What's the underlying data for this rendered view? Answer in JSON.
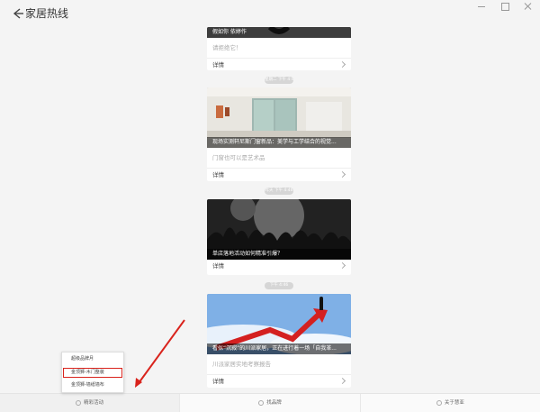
{
  "header": {
    "title": "家居热线"
  },
  "feed": {
    "cards": [
      {
        "caption": "假如你 依婷作",
        "subtitle": "请拒绝它！",
        "detail_label": "详情"
      },
      {
        "date_pill": "星期二 下午 4:46",
        "caption": "现场实测轩尼斯门窗新品：美学与工学结合的视觉...",
        "subtitle": "门窗也可以是艺术品",
        "detail_label": "详情"
      },
      {
        "date_pill": "昨天 下午 4:46",
        "caption": "单店落地活动如何精准引爆？",
        "detail_label": "详情"
      },
      {
        "date_pill": "下午 4:46",
        "caption": "看似“沉寂”的川派家居，正在进行着一场「自我革...",
        "subtitle": "川派家居实地考察报告",
        "detail_label": "详情"
      }
    ]
  },
  "bottom_nav": {
    "tabs": [
      {
        "label": "精彩活动"
      },
      {
        "label": "找品牌"
      },
      {
        "label": "关于慧亚"
      }
    ]
  },
  "popup_menu": {
    "items": [
      {
        "label": "超级品牌月"
      },
      {
        "label": "金顶狮-木门整装"
      },
      {
        "label": "金顶狮-墙纸墙布"
      }
    ],
    "highlighted_index": 1
  },
  "colors": {
    "annotation_red": "#d9231c",
    "caption_overlay": "rgba(0,0,0,0.55)"
  }
}
